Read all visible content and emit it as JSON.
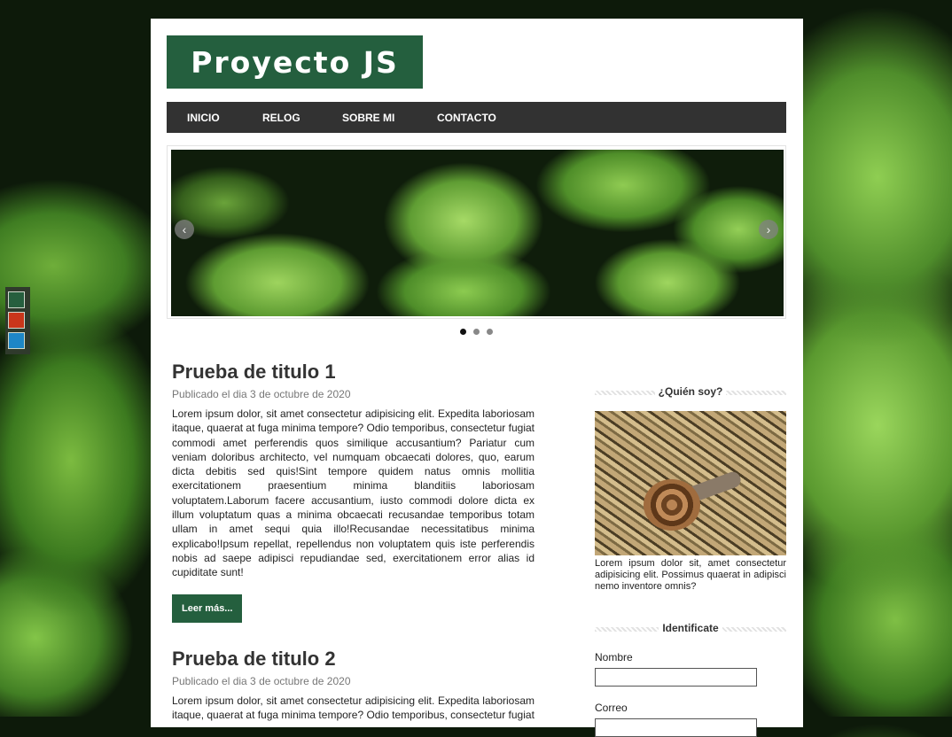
{
  "theme": {
    "colors": [
      "#265f3e",
      "#c9361b",
      "#1e86c7"
    ],
    "accent": "#245f3e",
    "nav_bg": "#323232"
  },
  "header": {
    "logo": "Proyecto JS"
  },
  "nav": {
    "items": [
      "INICIO",
      "RELOG",
      "SOBRE MI",
      "CONTACTO"
    ]
  },
  "slider": {
    "prev_icon": "‹",
    "next_icon": "›",
    "dot_count": 3,
    "active_index": 0
  },
  "posts": [
    {
      "title": "Prueba de titulo 1",
      "meta": "Publicado el dia 3 de octubre de 2020",
      "body": "Lorem ipsum dolor, sit amet consectetur adipisicing elit. Expedita laboriosam itaque, quaerat at fuga minima tempore? Odio temporibus, consectetur fugiat commodi amet perferendis quos similique accusantium? Pariatur cum veniam doloribus architecto, vel numquam obcaecati dolores, quo, earum dicta debitis sed quis!Sint tempore quidem natus omnis mollitia exercitationem praesentium minima blanditiis laboriosam voluptatem.Laborum facere accusantium, iusto commodi dolore dicta ex illum voluptatum quas a minima obcaecati recusandae temporibus totam ullam in amet sequi quia illo!Recusandae necessitatibus minima explicabo!Ipsum repellat, repellendus non voluptatem quis iste perferendis nobis ad saepe adipisci repudiandae sed, exercitationem error alias id cupiditate sunt!",
      "button": "Leer más..."
    },
    {
      "title": "Prueba de titulo 2",
      "meta": "Publicado el dia 3 de octubre de 2020",
      "body": "Lorem ipsum dolor, sit amet consectetur adipisicing elit. Expedita laboriosam itaque, quaerat at fuga minima tempore? Odio temporibus, consectetur fugiat"
    }
  ],
  "sidebar": {
    "about_title": "¿Quién soy?",
    "about_text": "Lorem ipsum dolor sit, amet consectetur adipisicing elit. Possimus quaerat in adipisci nemo inventore omnis?",
    "login_title": "Identificate",
    "name_label": "Nombre",
    "email_label": "Correo"
  }
}
